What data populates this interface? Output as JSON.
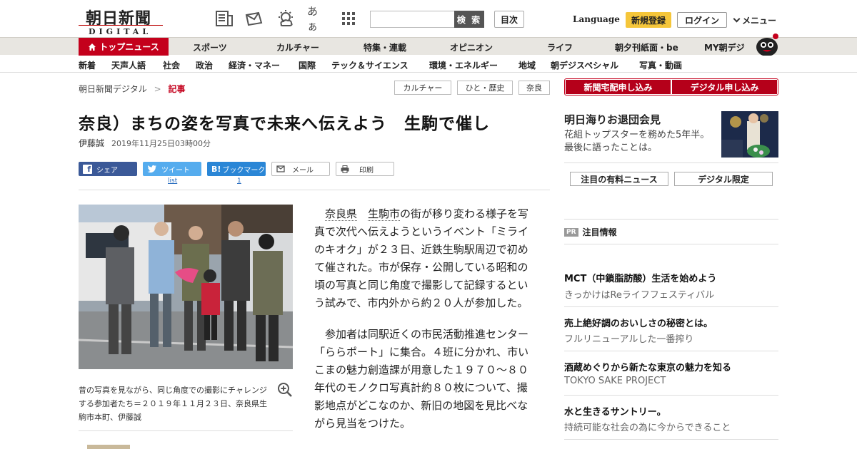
{
  "header": {
    "logo_jp": "朝日新聞",
    "logo_en": "DIGITAL",
    "search_label": "検 索",
    "toc_label": "目次",
    "language": "Language",
    "register": "新規登録",
    "login": "ログイン",
    "menu": "メニュー",
    "icons": [
      "paper-icon",
      "mail-icon",
      "weather-icon",
      "font-size-icon",
      "grid-icon"
    ],
    "font_size_glyph": "あぁ"
  },
  "nav1": {
    "top": "トップニュース",
    "items": [
      "スポーツ",
      "カルチャー",
      "特集・連載",
      "オピニオン",
      "ライフ",
      "朝夕刊紙面・be",
      "MY朝デジ"
    ]
  },
  "nav2": {
    "items": [
      "新着",
      "天声人語",
      "社会",
      "政治",
      "経済・マネー",
      "国際",
      "テック＆サイエンス",
      "環境・エネルギー",
      "地域",
      "朝デジスペシャル",
      "写真・動画"
    ]
  },
  "breadcrumb": {
    "home": "朝日新聞デジタル",
    "sep": ">",
    "current": "記事"
  },
  "tags": [
    "カルチャー",
    "ひと・歴史",
    "奈良"
  ],
  "article": {
    "title": "奈良）まちの姿を写真で未来へ伝えよう　生駒で催し",
    "author": "伊藤誠",
    "date": "2019年11月25日03時00分",
    "share": {
      "facebook": "シェア",
      "twitter": "ツイート",
      "twitter_count": "list",
      "hatena": "ブックマーク",
      "hatena_count": "1",
      "mail": "メール",
      "print": "印刷"
    },
    "caption": "昔の写真を見ながら、同じ角度での撮影にチャレンジする参加者たち＝２０１９年１１月２３日、奈良県生駒市本町、伊藤誠",
    "p1_link1": "奈良県",
    "p1_link2": "生駒市",
    "p1_rest": "の街が移り変わる様子を写真で次代へ伝えようというイベント「ミライのキオク」が２３日、近鉄生駒駅周辺で初めて催された。市が保存・公開している昭和の頃の写真と同じ角度で撮影して記録するという試みで、市内外から約２０人が参加した。",
    "p2": "参加者は同駅近くの市民活動推進センター「ららポート」に集合。４班に分かれ、市いこまの魅力創造課が用意した１９７０～８０年代のモノクロ写真計約８０枚について、撮影地点がどこなのか、新旧の地図を見比べながら見当をつけた。"
  },
  "sidebar": {
    "subscribe": [
      "新聞宅配申し込み",
      "デジタル申し込み"
    ],
    "feature_title": "明日海りお退団会見",
    "feature_text": "花組トップスターを務めた5年半。最後に語ったことは。",
    "buttons": [
      "注目の有料ニュース",
      "デジタル限定"
    ],
    "pr_badge": "PR",
    "pr_title": "注目情報",
    "ads": [
      {
        "title": "MCT（中鎖脂肪酸）生活を始めよう",
        "sub": "きっかけはReライフフェスティバル"
      },
      {
        "title": "売上絶好調のおいしさの秘密とは。",
        "sub": "フルリニューアルした一番搾り"
      },
      {
        "title": "酒蔵めぐりから新たな東京の魅力を知る",
        "sub": "TOKYO SAKE PROJECT"
      },
      {
        "title": "水と生きるサントリー。",
        "sub": "持続可能な社会の為に今からできること"
      }
    ]
  },
  "colors": {
    "brand_red": "#c4001c",
    "yellow": "#f5c63a",
    "facebook": "#3b5998",
    "twitter": "#55acee",
    "hatena": "#2a86d6"
  }
}
